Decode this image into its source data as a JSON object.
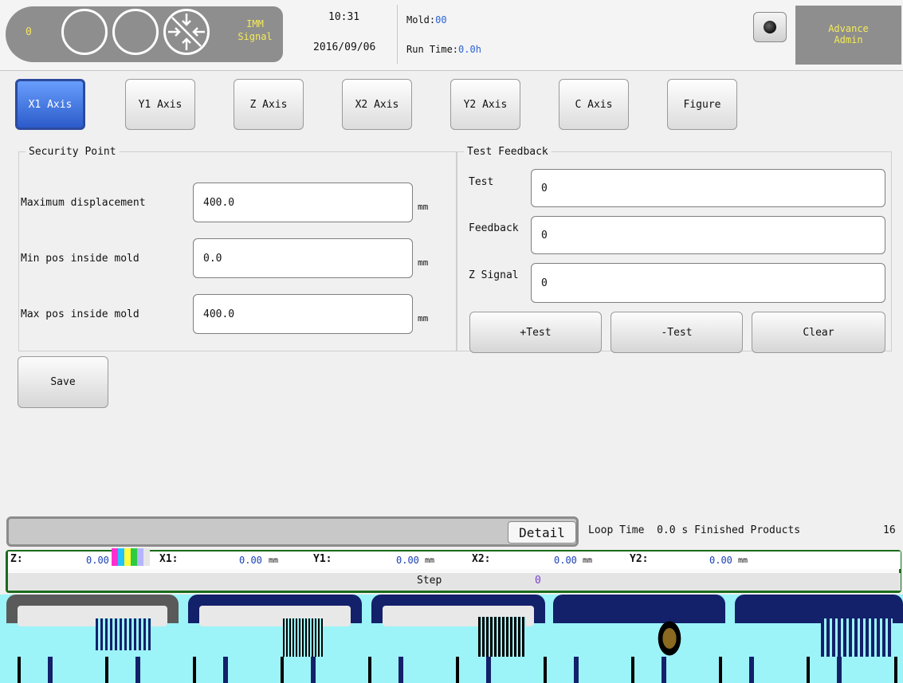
{
  "header": {
    "counter": "0",
    "imm_signal": [
      "IMM",
      "Signal"
    ],
    "time": "10:31",
    "date": "2016/09/06",
    "mold_label": "Mold:",
    "mold_value": "00",
    "runtime_label": "Run Time:",
    "runtime_value": "0.0h",
    "user_level": "Advance",
    "user_name": "Admin"
  },
  "tabs": [
    {
      "label": "X1 Axis",
      "active": true
    },
    {
      "label": "Y1 Axis"
    },
    {
      "label": "Z Axis"
    },
    {
      "label": "X2 Axis"
    },
    {
      "label": "Y2 Axis"
    },
    {
      "label": "C Axis"
    },
    {
      "label": "Figure"
    }
  ],
  "security": {
    "title": "Security Point",
    "rows": [
      {
        "label": "Maximum displacement",
        "value": "400.0",
        "unit": "mm"
      },
      {
        "label": "Min pos inside mold",
        "value": "0.0",
        "unit": "mm"
      },
      {
        "label": "Max pos inside mold",
        "value": "400.0",
        "unit": "mm"
      }
    ]
  },
  "feedback": {
    "title": "Test Feedback",
    "rows": [
      {
        "label": "Test",
        "value": "0"
      },
      {
        "label": "Feedback",
        "value": "0"
      },
      {
        "label": "Z Signal",
        "value": "0"
      }
    ],
    "buttons": [
      "+Test",
      "-Test",
      "Clear"
    ]
  },
  "save_label": "Save",
  "status": {
    "detail_label": "Detail",
    "loop_time_label": "Loop Time",
    "loop_time_value": "0.0 s",
    "finished_label": "Finished Products",
    "finished_value": "16"
  },
  "positions": [
    {
      "label": "Z:",
      "value": "0.00"
    },
    {
      "label": "X1:",
      "value": "0.00",
      "unit": "mm"
    },
    {
      "label": "Y1:",
      "value": "0.00",
      "unit": "mm"
    },
    {
      "label": "X2:",
      "value": "0.00",
      "unit": "mm"
    },
    {
      "label": "Y2:",
      "value": "0.00",
      "unit": "mm"
    }
  ],
  "step": {
    "label": "Step",
    "value": "0"
  },
  "colors": {
    "accent": "#2a59c8",
    "panel": "#8e8e8e",
    "signal_text": "#f4eb58",
    "position_border": "#1a6b1a"
  }
}
